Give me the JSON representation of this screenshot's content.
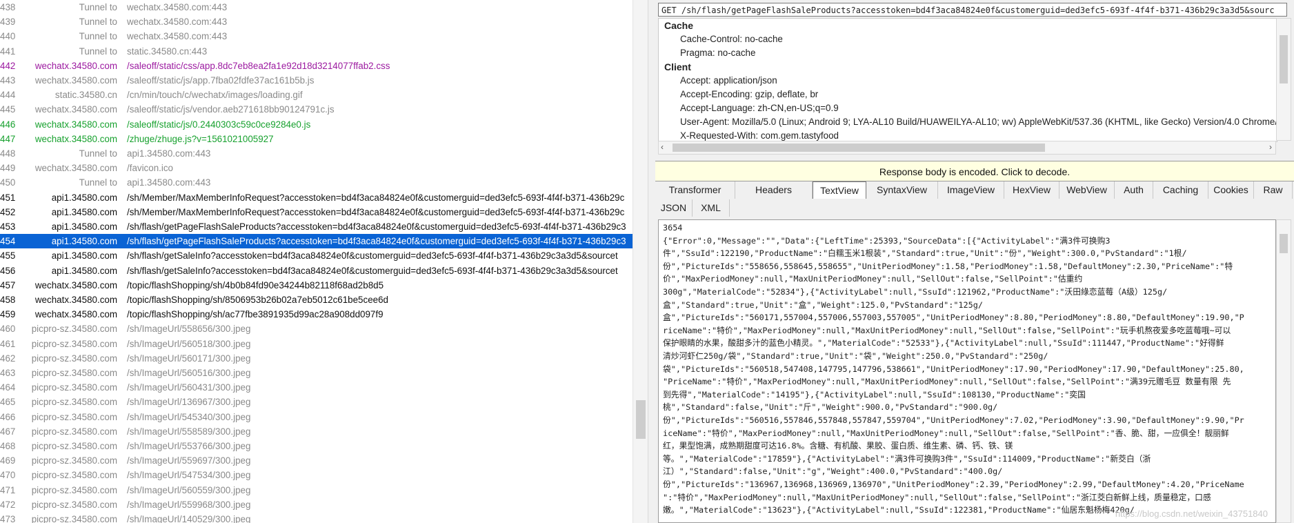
{
  "session_list": [
    {
      "num": "438",
      "host": "Tunnel to",
      "url": "wechatx.34580.com:443",
      "color": "gray"
    },
    {
      "num": "439",
      "host": "Tunnel to",
      "url": "wechatx.34580.com:443",
      "color": "gray"
    },
    {
      "num": "440",
      "host": "Tunnel to",
      "url": "wechatx.34580.com:443",
      "color": "gray"
    },
    {
      "num": "441",
      "host": "Tunnel to",
      "url": "static.34580.cn:443",
      "color": "gray"
    },
    {
      "num": "442",
      "host": "wechatx.34580.com",
      "url": "/saleoff/static/css/app.8dc7eb8ea2fa1e92d18d3214077ffab2.css",
      "color": "purple"
    },
    {
      "num": "443",
      "host": "wechatx.34580.com",
      "url": "/saleoff/static/js/app.7fba02fdfe37ac161b5b.js",
      "color": "gray"
    },
    {
      "num": "444",
      "host": "static.34580.cn",
      "url": "/cn/min/touch/c/wechatx/images/loading.gif",
      "color": "gray"
    },
    {
      "num": "445",
      "host": "wechatx.34580.com",
      "url": "/saleoff/static/js/vendor.aeb271618bb90124791c.js",
      "color": "gray"
    },
    {
      "num": "446",
      "host": "wechatx.34580.com",
      "url": "/saleoff/static/js/0.2440303c59c0ce9284e0.js",
      "color": "green"
    },
    {
      "num": "447",
      "host": "wechatx.34580.com",
      "url": "/zhuge/zhuge.js?v=1561021005927",
      "color": "green"
    },
    {
      "num": "448",
      "host": "Tunnel to",
      "url": "api1.34580.com:443",
      "color": "gray"
    },
    {
      "num": "449",
      "host": "wechatx.34580.com",
      "url": "/favicon.ico",
      "color": "gray"
    },
    {
      "num": "450",
      "host": "Tunnel to",
      "url": "api1.34580.com:443",
      "color": "gray"
    },
    {
      "num": "451",
      "host": "api1.34580.com",
      "url": "/sh/Member/MaxMemberInfoRequest?accesstoken=bd4f3aca84824e0f&customerguid=ded3efc5-693f-4f4f-b371-436b29c",
      "color": "black"
    },
    {
      "num": "452",
      "host": "api1.34580.com",
      "url": "/sh/Member/MaxMemberInfoRequest?accesstoken=bd4f3aca84824e0f&customerguid=ded3efc5-693f-4f4f-b371-436b29c",
      "color": "black"
    },
    {
      "num": "453",
      "host": "api1.34580.com",
      "url": "/sh/flash/getPageFlashSaleProducts?accesstoken=bd4f3aca84824e0f&customerguid=ded3efc5-693f-4f4f-b371-436b29c3",
      "color": "black"
    },
    {
      "num": "454",
      "host": "api1.34580.com",
      "url": "/sh/flash/getPageFlashSaleProducts?accesstoken=bd4f3aca84824e0f&customerguid=ded3efc5-693f-4f4f-b371-436b29c3",
      "color": "selected"
    },
    {
      "num": "455",
      "host": "api1.34580.com",
      "url": "/sh/flash/getSaleInfo?accesstoken=bd4f3aca84824e0f&customerguid=ded3efc5-693f-4f4f-b371-436b29c3a3d5&sourcet",
      "color": "black"
    },
    {
      "num": "456",
      "host": "api1.34580.com",
      "url": "/sh/flash/getSaleInfo?accesstoken=bd4f3aca84824e0f&customerguid=ded3efc5-693f-4f4f-b371-436b29c3a3d5&sourcet",
      "color": "black"
    },
    {
      "num": "457",
      "host": "wechatx.34580.com",
      "url": "/topic/flashShopping/sh/4b0b84fd90e34244b82118f68ad2b8d5",
      "color": "black"
    },
    {
      "num": "458",
      "host": "wechatx.34580.com",
      "url": "/topic/flashShopping/sh/8506953b26b02a7eb5012c61be5cee6d",
      "color": "black"
    },
    {
      "num": "459",
      "host": "wechatx.34580.com",
      "url": "/topic/flashShopping/sh/ac77fbe3891935d99ac28a908dd097f9",
      "color": "black"
    },
    {
      "num": "460",
      "host": "picpro-sz.34580.com",
      "url": "/sh/ImageUrl/558656/300.jpeg",
      "color": "gray"
    },
    {
      "num": "461",
      "host": "picpro-sz.34580.com",
      "url": "/sh/ImageUrl/560518/300.jpeg",
      "color": "gray"
    },
    {
      "num": "462",
      "host": "picpro-sz.34580.com",
      "url": "/sh/ImageUrl/560171/300.jpeg",
      "color": "gray"
    },
    {
      "num": "463",
      "host": "picpro-sz.34580.com",
      "url": "/sh/ImageUrl/560516/300.jpeg",
      "color": "gray"
    },
    {
      "num": "464",
      "host": "picpro-sz.34580.com",
      "url": "/sh/ImageUrl/560431/300.jpeg",
      "color": "gray"
    },
    {
      "num": "465",
      "host": "picpro-sz.34580.com",
      "url": "/sh/ImageUrl/136967/300.jpeg",
      "color": "gray"
    },
    {
      "num": "466",
      "host": "picpro-sz.34580.com",
      "url": "/sh/ImageUrl/545340/300.jpeg",
      "color": "gray"
    },
    {
      "num": "467",
      "host": "picpro-sz.34580.com",
      "url": "/sh/ImageUrl/558589/300.jpeg",
      "color": "gray"
    },
    {
      "num": "468",
      "host": "picpro-sz.34580.com",
      "url": "/sh/ImageUrl/553766/300.jpeg",
      "color": "gray"
    },
    {
      "num": "469",
      "host": "picpro-sz.34580.com",
      "url": "/sh/ImageUrl/559697/300.jpeg",
      "color": "gray"
    },
    {
      "num": "470",
      "host": "picpro-sz.34580.com",
      "url": "/sh/ImageUrl/547534/300.jpeg",
      "color": "gray"
    },
    {
      "num": "471",
      "host": "picpro-sz.34580.com",
      "url": "/sh/ImageUrl/560559/300.jpeg",
      "color": "gray"
    },
    {
      "num": "472",
      "host": "picpro-sz.34580.com",
      "url": "/sh/ImageUrl/559968/300.jpeg",
      "color": "gray"
    },
    {
      "num": "473",
      "host": "picpro-sz.34580.com",
      "url": "/sh/ImageUrl/140529/300.jpeg",
      "color": "gray"
    }
  ],
  "request": {
    "url_line": "GET /sh/flash/getPageFlashSaleProducts?accesstoken=bd4f3aca84824e0f&customerguid=ded3efc5-693f-4f4f-b371-436b29c3a3d5&sourc",
    "groups": [
      {
        "title": "Cache",
        "lines": [
          "Cache-Control: no-cache",
          "Pragma: no-cache"
        ]
      },
      {
        "title": "Client",
        "lines": [
          "Accept: application/json",
          "Accept-Encoding: gzip, deflate, br",
          "Accept-Language: zh-CN,en-US;q=0.9",
          "User-Agent: Mozilla/5.0 (Linux; Android 9; LYA-AL10 Build/HUAWEILYA-AL10; wv) AppleWebKit/537.36 (KHTML, like Gecko) Version/4.0 Chrome/6",
          "X-Requested-With: com.gem.tastyfood"
        ]
      }
    ]
  },
  "decode_bar": "Response body is encoded. Click to decode.",
  "response_tabs_row1": [
    "Transformer",
    "Headers",
    "TextView",
    "SyntaxView",
    "ImageView",
    "HexView",
    "WebView",
    "Auth",
    "Caching",
    "Cookies",
    "Raw"
  ],
  "response_tabs_row2": [
    "JSON",
    "XML"
  ],
  "active_tab": "TextView",
  "body_lines": [
    "3654",
    "{\"Error\":0,\"Message\":\"\",\"Data\":{\"LeftTime\":25393,\"SourceData\":[{\"ActivityLabel\":\"满3件可换购3",
    "件\",\"SsuId\":122190,\"ProductName\":\"白糯玉米1根装\",\"Standard\":true,\"Unit\":\"份\",\"Weight\":300.0,\"PvStandard\":\"1根/",
    "份\",\"PictureIds\":\"558656,558645,558655\",\"UnitPeriodMoney\":1.58,\"PeriodMoney\":1.58,\"DefaultMoney\":2.30,\"PriceName\":\"特",
    "价\",\"MaxPeriodMoney\":null,\"MaxUnitPeriodMoney\":null,\"SellOut\":false,\"SellPoint\":\"估重约",
    "300g\",\"MaterialCode\":\"52834\"},{\"ActivityLabel\":null,\"SsuId\":121962,\"ProductName\":\"沃田綠恋蓝莓（A级）125g/",
    "盒\",\"Standard\":true,\"Unit\":\"盒\",\"Weight\":125.0,\"PvStandard\":\"125g/",
    "盒\",\"PictureIds\":\"560171,557004,557006,557003,557005\",\"UnitPeriodMoney\":8.80,\"PeriodMoney\":8.80,\"DefaultMoney\":19.90,\"P",
    "riceName\":\"特价\",\"MaxPeriodMoney\":null,\"MaxUnitPeriodMoney\":null,\"SellOut\":false,\"SellPoint\":\"玩手机熬夜爱多吃蓝莓哦~可以",
    "保护眼睛的水果，酸甜多汁的蓝色小精灵。\",\"MaterialCode\":\"52533\"},{\"ActivityLabel\":null,\"SsuId\":111447,\"ProductName\":\"好得鲜",
    "清炒河虾仁250g/袋\",\"Standard\":true,\"Unit\":\"袋\",\"Weight\":250.0,\"PvStandard\":\"250g/",
    "袋\",\"PictureIds\":\"560518,547408,147795,147796,538661\",\"UnitPeriodMoney\":17.90,\"PeriodMoney\":17.90,\"DefaultMoney\":25.80,",
    "\"PriceName\":\"特价\",\"MaxPeriodMoney\":null,\"MaxUnitPeriodMoney\":null,\"SellOut\":false,\"SellPoint\":\"满39元赠毛豆 数量有限 先",
    "到先得\",\"MaterialCode\":\"14195\"},{\"ActivityLabel\":null,\"SsuId\":108130,\"ProductName\":\"奕国",
    "桃\",\"Standard\":false,\"Unit\":\"斤\",\"Weight\":900.0,\"PvStandard\":\"900.0g/",
    "份\",\"PictureIds\":\"560516,557846,557848,557847,559704\",\"UnitPeriodMoney\":7.02,\"PeriodMoney\":3.90,\"DefaultMoney\":9.90,\"Pr",
    "iceName\":\"特价\",\"MaxPeriodMoney\":null,\"MaxUnitPeriodMoney\":null,\"SellOut\":false,\"SellPoint\":\"香、脆、甜，一应俱全！靓丽鲜",
    "红，果型饱满，成熟期甜度可达16.8%。含糖、有机酸、果胶、蛋白质、维生素、磷、钙、铁、镁",
    "等。\",\"MaterialCode\":\"17859\"},{\"ActivityLabel\":\"满3件可换购3件\",\"SsuId\":114009,\"ProductName\":\"新茭白（浙",
    "江）\",\"Standard\":false,\"Unit\":\"g\",\"Weight\":400.0,\"PvStandard\":\"400.0g/",
    "份\",\"PictureIds\":\"136967,136968,136969,136970\",\"UnitPeriodMoney\":2.39,\"PeriodMoney\":2.99,\"DefaultMoney\":4.20,\"PriceName",
    "\":\"特价\",\"MaxPeriodMoney\":null,\"MaxUnitPeriodMoney\":null,\"SellOut\":false,\"SellPoint\":\"浙江茭白新鲜上线，质量稳定，口感",
    "嫩。\",\"MaterialCode\":\"13623\"},{\"ActivityLabel\":null,\"SsuId\":122381,\"ProductName\":\"仙居东魁杨梅420g/"
  ],
  "watermark": "https://blog.csdn.net/weixin_43751840"
}
